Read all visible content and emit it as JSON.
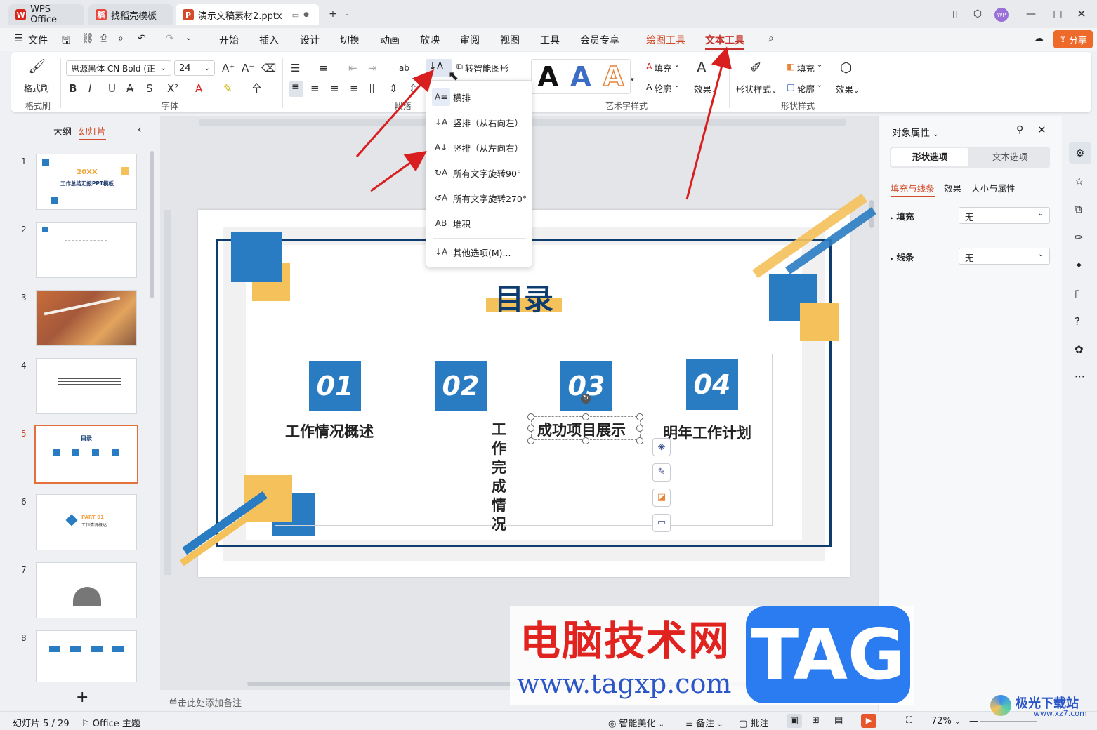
{
  "titlebar": {
    "app_tab": "WPS Office",
    "tab2": "找稻壳模板",
    "tab3": "演示文稿素材2.pptx",
    "avatar": "WP"
  },
  "menubar": {
    "file": "文件",
    "items": [
      "开始",
      "插入",
      "设计",
      "切换",
      "动画",
      "放映",
      "审阅",
      "视图",
      "工具",
      "会员专享"
    ],
    "drawing_tools": "绘图工具",
    "text_tools": "文本工具",
    "share": "分享"
  },
  "ribbon": {
    "format_painter": "格式刷",
    "format_painter_group": "格式刷",
    "font_name": "思源黑体 CN Bold (正",
    "font_size": "24",
    "font_group": "字体",
    "paragraph_group": "段落",
    "smart_shape": "转智能图形",
    "art_group": "艺术字样式",
    "text_fill": "填充",
    "text_outline": "轮廓",
    "text_effect": "效果",
    "shape_style": "形状样式",
    "shape_fill": "填充",
    "shape_outline": "轮廓",
    "shape_effect": "效果",
    "shape_group": "形状样式",
    "art_letter": "A"
  },
  "dropdown": {
    "items": [
      "横排",
      "竖排（从右向左）",
      "竖排（从左向右）",
      "所有文字旋转90°",
      "所有文字旋转270°",
      "堆积",
      "其他选项(M)..."
    ]
  },
  "leftpanel": {
    "tab_outline": "大纲",
    "tab_slides": "幻灯片",
    "slide_numbers": [
      "1",
      "2",
      "3",
      "4",
      "5",
      "6",
      "7",
      "8"
    ],
    "thumb1_title": "20XX",
    "thumb1_sub": "工作总结汇报PPT模板",
    "thumb5_title": "目录",
    "thumb6_part": "PART 01",
    "thumb6_sub": "工作情况概述",
    "add": "+"
  },
  "slide": {
    "title": "目录",
    "items": [
      {
        "num": "01",
        "text": "工作情况概述"
      },
      {
        "num": "02",
        "text": "工作完成情况"
      },
      {
        "num": "03",
        "text": "成功项目展示"
      },
      {
        "num": "04",
        "text": "明年工作计划"
      }
    ]
  },
  "notes_placeholder": "单击此处添加备注",
  "rightpanel": {
    "title": "对象属性",
    "tab_shape": "形状选项",
    "tab_text": "文本选项",
    "sub_fill_line": "填充与线条",
    "sub_effect": "效果",
    "sub_size": "大小与属性",
    "fill_label": "填充",
    "fill_value": "无",
    "line_label": "线条",
    "line_value": "无"
  },
  "statusbar": {
    "slide_count": "幻灯片 5 / 29",
    "theme": "Office 主题",
    "beautify": "智能美化",
    "notes": "备注",
    "comments": "批注",
    "zoom": "72%"
  },
  "watermark": {
    "cn": "电脑技术网",
    "url": "www.tagxp.com",
    "tag": "TAG",
    "corner": "极光下载站",
    "corner_url": "www.xz7.com"
  },
  "colors": {
    "accent_blue": "#2a7cc2",
    "accent_yellow": "#f5c15a",
    "dark_navy": "#0f3c6e",
    "arrow_red": "#d81e1e"
  }
}
